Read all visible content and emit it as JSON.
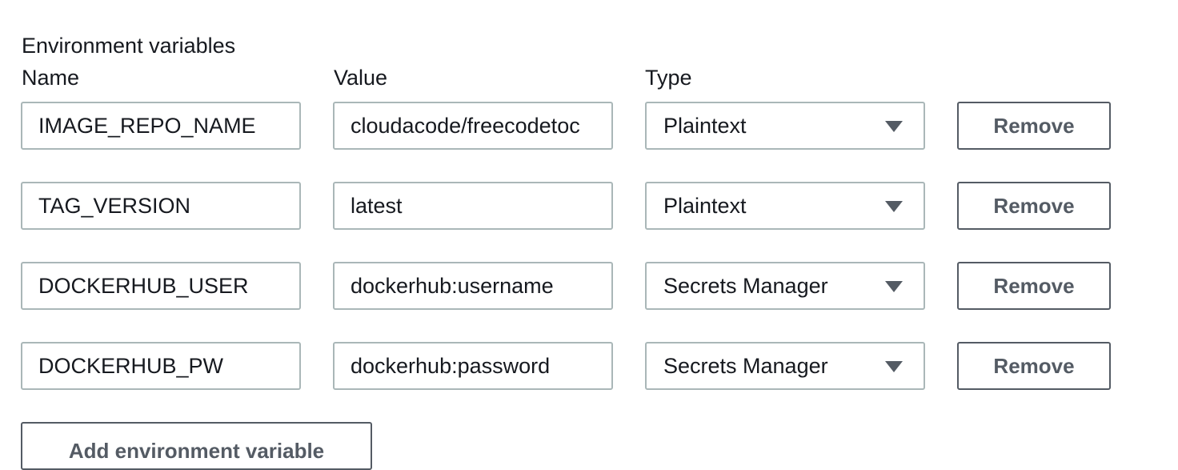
{
  "section": {
    "title": "Environment variables"
  },
  "columns": {
    "name_label": "Name",
    "value_label": "Value",
    "type_label": "Type"
  },
  "variables": [
    {
      "name": "IMAGE_REPO_NAME",
      "value": "cloudacode/freecodetoc",
      "type": "Plaintext",
      "remove_label": "Remove"
    },
    {
      "name": "TAG_VERSION",
      "value": "latest",
      "type": "Plaintext",
      "remove_label": "Remove"
    },
    {
      "name": "DOCKERHUB_USER",
      "value": "dockerhub:username",
      "type": "Secrets Manager",
      "remove_label": "Remove"
    },
    {
      "name": "DOCKERHUB_PW",
      "value": "dockerhub:password",
      "type": "Secrets Manager",
      "remove_label": "Remove"
    }
  ],
  "actions": {
    "add_label": "Add environment variable"
  },
  "icons": {
    "dropdown": "caret-down-icon"
  }
}
